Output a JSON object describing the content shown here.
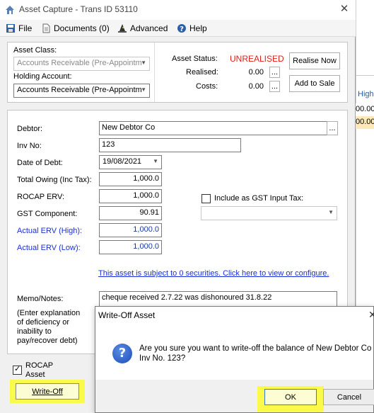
{
  "window": {
    "title": "Asset Capture - Trans ID 53110"
  },
  "menu": [
    {
      "label": "File",
      "icon": "save-icon"
    },
    {
      "label": "Documents (0)",
      "icon": "document-icon"
    },
    {
      "label": "Advanced",
      "icon": "wizard-hat-icon"
    },
    {
      "label": "Help",
      "icon": "help-icon"
    }
  ],
  "asset": {
    "class_label": "Asset Class:",
    "class_value": "Accounts Receivable (Pre-Appointm",
    "holding_label": "Holding Account:",
    "holding_value": "Accounts Receivable (Pre-Appointm",
    "status_label": "Asset Status:",
    "status_value": "UNREALISED",
    "realised_label": "Realised:",
    "realised_value": "0.00",
    "costs_label": "Costs:",
    "costs_value": "0.00",
    "ellipsis": "...",
    "realise_now": "Realise Now",
    "add_to_sale": "Add to Sale",
    "status_color": "#e0201a"
  },
  "debt": {
    "debtor_label": "Debtor:",
    "debtor_value": "New Debtor Co",
    "inv_label": "Inv No:",
    "inv_value": "123",
    "date_label": "Date of Debt:",
    "date_value": "19/08/2021",
    "total_label": "Total Owing (Inc Tax):",
    "total_value": "1,000.0",
    "rocap_label": "ROCAP ERV:",
    "rocap_value": "1,000.0",
    "gst_label": "GST Component:",
    "gst_value": "90.91",
    "erv_high_label": "Actual ERV (High):",
    "erv_high_value": "1,000.0",
    "erv_low_label": "Actual ERV (Low):",
    "erv_low_value": "1,000.0",
    "include_gst_label": "Include as GST Input Tax:",
    "include_gst_checked": false,
    "securities_link": "This asset is subject to 0 securities.  Click here to view or configure.",
    "memo_label": "Memo/Notes:",
    "memo_value": "cheque received 2.7.22 was dishonoured 31.8.22",
    "memo_hint": "(Enter explanation of deficiency or inability to pay/recover debt)"
  },
  "footer": {
    "rocap_asset_label": "ROCAP Asset",
    "rocap_asset_checked": true,
    "write_off_button": "Write-Off"
  },
  "background": {
    "high_label": "High",
    "val1": "00.00",
    "val2": "00.00"
  },
  "dialog": {
    "title": "Write-Off Asset",
    "close": "✕",
    "message": "Are you sure you want to write-off the balance of New Debtor Co Inv No. 123?",
    "ok": "OK",
    "cancel": "Cancel",
    "highlight_color": "#fafa4a"
  }
}
